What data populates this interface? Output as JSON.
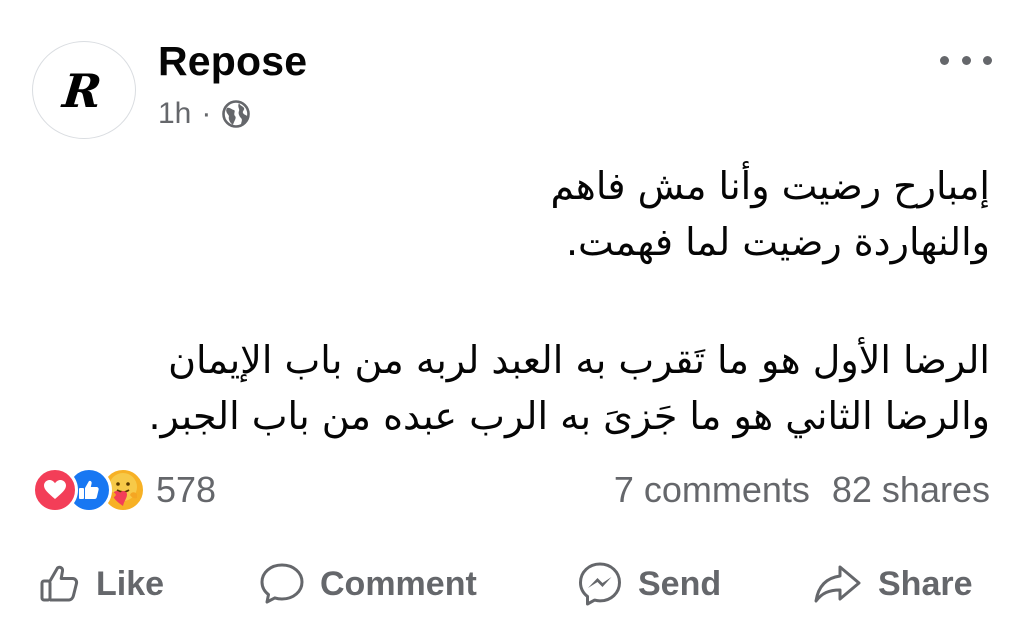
{
  "post": {
    "avatar_letter": "R",
    "page_name": "Repose",
    "time": "1h",
    "separator": "·",
    "privacy_icon": "globe-icon",
    "more_icon": "more-options-icon",
    "paragraphs": [
      [
        "إمبارح رضيت وأنا مش فاهم",
        "والنهاردة رضيت لما فهمت."
      ],
      [
        "الرضا الأول هو ما تَقرب به العبد لربه من باب الإيمان",
        "والرضا الثاني هو ما جَزىَ به الرب عبده من باب الجبر."
      ]
    ],
    "reactions": {
      "icons": [
        "love-reaction-icon",
        "like-reaction-icon",
        "care-reaction-icon"
      ],
      "count": "578"
    },
    "comments": "7 comments",
    "shares": "82 shares"
  },
  "actions": {
    "like": "Like",
    "comment": "Comment",
    "send": "Send",
    "share": "Share"
  },
  "colors": {
    "text": "#050505",
    "secondary": "#65676b",
    "love": "#f33e58",
    "like": "#1877f2",
    "care": "#f7b125"
  }
}
